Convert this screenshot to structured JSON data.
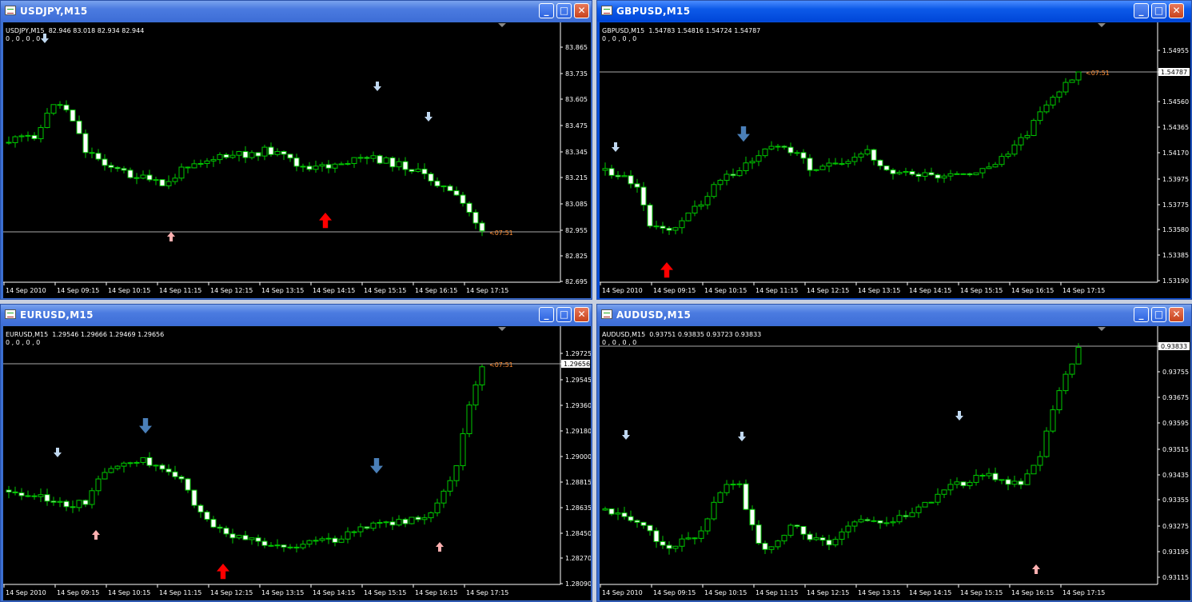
{
  "colors": {
    "candle_up": "#00c800",
    "candle_fill_down": "#ffffff",
    "grid": "#ffffff",
    "countdown": "#ff8c32",
    "arrow_red": "#ff0000",
    "arrow_pink": "#ffb0b0",
    "arrow_lightblue": "#c0d8f0",
    "arrow_blue": "#4a7fb8"
  },
  "windows": [
    {
      "title": "USDJPY,M15",
      "ohlc": "USDJPY,M15  82.946 83.018 82.934 82.944",
      "indicator": "0 , 0 , 0 , 0",
      "price_labels": [
        "83.865",
        "83.735",
        "83.605",
        "83.475",
        "83.345",
        "83.215",
        "83.085",
        "82.955",
        "82.825",
        "82.695"
      ],
      "current_price": "82.944",
      "countdown": "<07:51",
      "time_labels": [
        "14 Sep 2010",
        "14 Sep 09:15",
        "14 Sep 10:15",
        "14 Sep 11:15",
        "14 Sep 12:15",
        "14 Sep 13:15",
        "14 Sep 14:15",
        "14 Sep 15:15",
        "14 Sep 16:15",
        "14 Sep 17:15"
      ]
    },
    {
      "title": "GBPUSD,M15",
      "ohlc": "GBPUSD,M15  1.54783 1.54816 1.54724 1.54787",
      "indicator": "0 , 0 , 0 , 0",
      "price_labels": [
        "1.54955",
        "1.54787",
        "1.54560",
        "1.54365",
        "1.54170",
        "1.53975",
        "1.53775",
        "1.53580",
        "1.53385",
        "1.53190"
      ],
      "current_price": "1.54787",
      "countdown": "<07:51",
      "time_labels": [
        "14 Sep 2010",
        "14 Sep 09:15",
        "14 Sep 10:15",
        "14 Sep 11:15",
        "14 Sep 12:15",
        "14 Sep 13:15",
        "14 Sep 14:15",
        "14 Sep 15:15",
        "14 Sep 16:15",
        "14 Sep 17:15"
      ]
    },
    {
      "title": "EURUSD,M15",
      "ohlc": "EURUSD,M15  1.29546 1.29666 1.29469 1.29656",
      "indicator": "0 , 0 , 0 , 0",
      "price_labels": [
        "1.29725",
        "1.29656",
        "1.29545",
        "1.29360",
        "1.29180",
        "1.29000",
        "1.28815",
        "1.28635",
        "1.28450",
        "1.28270",
        "1.28090"
      ],
      "current_price": "1.29656",
      "countdown": "<07:51",
      "time_labels": [
        "14 Sep 2010",
        "14 Sep 09:15",
        "14 Sep 10:15",
        "14 Sep 11:15",
        "14 Sep 12:15",
        "14 Sep 13:15",
        "14 Sep 14:15",
        "14 Sep 15:15",
        "14 Sep 16:15",
        "14 Sep 17:15"
      ]
    },
    {
      "title": "AUDUSD,M15",
      "ohlc": "AUDUSD,M15  0.93751 0.93835 0.93723 0.93833",
      "indicator": "0 , 0 , 0 , 0",
      "price_labels": [
        "0.93833",
        "0.93755",
        "0.93675",
        "0.93595",
        "0.93515",
        "0.93435",
        "0.93355",
        "0.93275",
        "0.93195",
        "0.93115"
      ],
      "current_price": "0.93833",
      "countdown": "",
      "time_labels": [
        "14 Sep 2010",
        "14 Sep 09:15",
        "14 Sep 10:15",
        "14 Sep 11:15",
        "14 Sep 12:15",
        "14 Sep 13:15",
        "14 Sep 14:15",
        "14 Sep 15:15",
        "14 Sep 16:15",
        "14 Sep 17:15"
      ]
    }
  ],
  "window_buttons": {
    "minimize": "_",
    "maximize": "□",
    "close": "✕"
  }
}
